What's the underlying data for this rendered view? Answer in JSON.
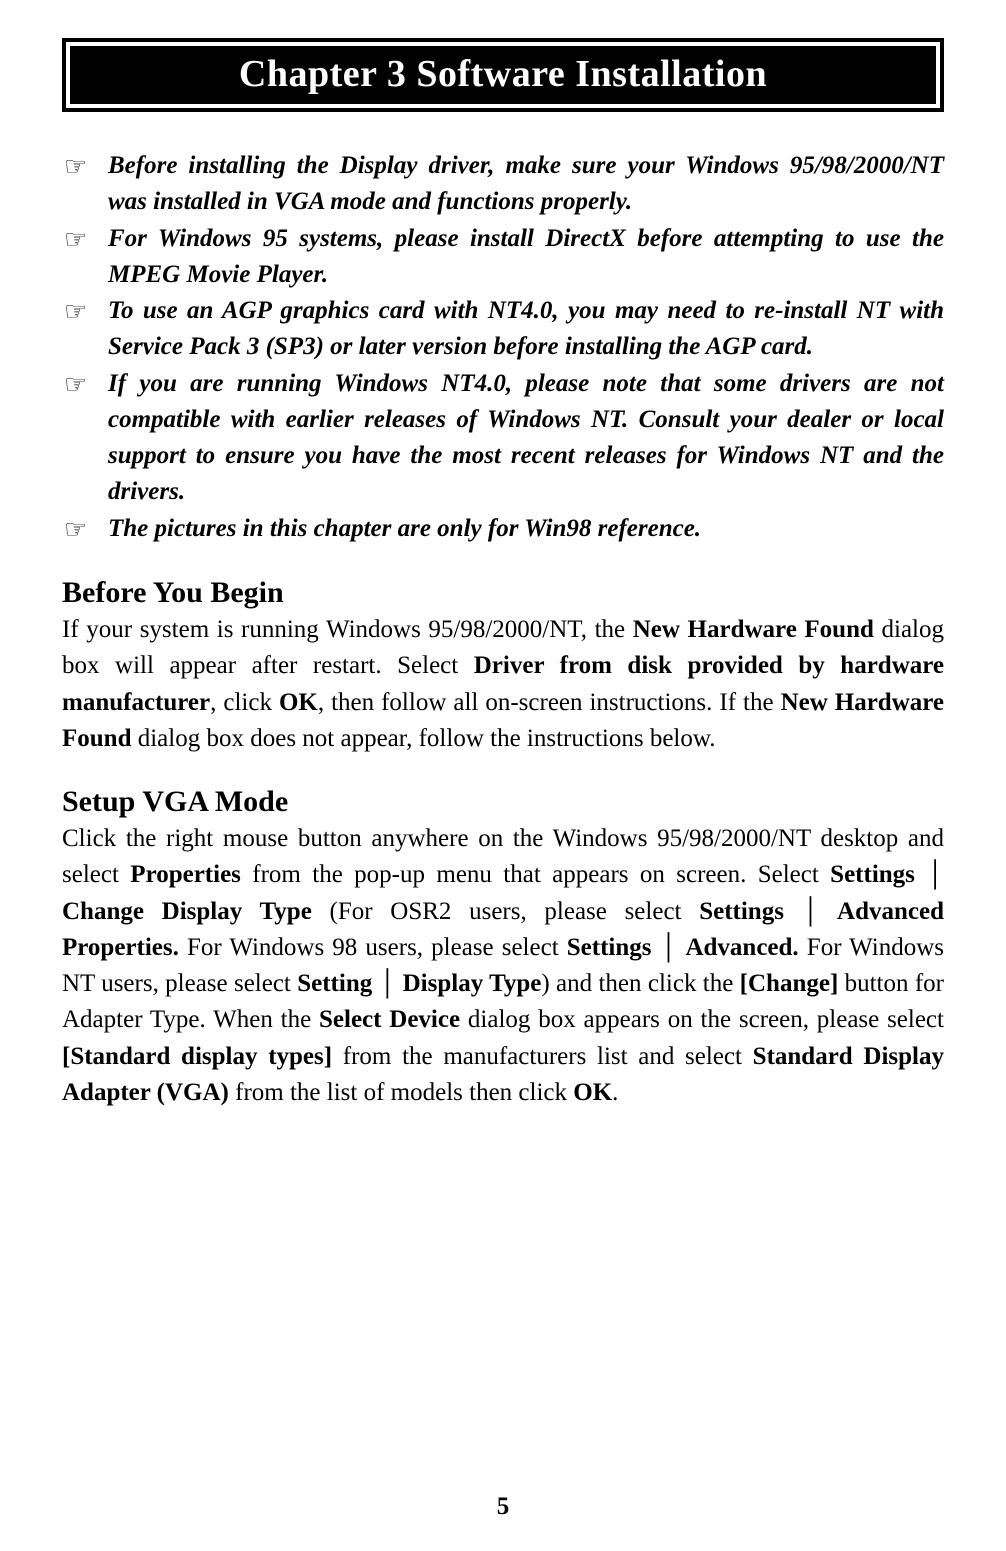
{
  "chapter": {
    "title": "Chapter 3 Software Installation"
  },
  "notes": {
    "items": [
      "Before installing the Display driver, make sure your Windows 95/98/2000/NT was installed in VGA mode and functions properly.",
      "For Windows 95 systems, please install DirectX before attempting to use the MPEG Movie Player.",
      "To use an AGP graphics card with NT4.0, you may need to re-install NT with Service Pack 3 (SP3) or later version before installing the AGP card.",
      "If you are running Windows NT4.0, please note that some drivers are not compatible with earlier releases of Windows NT.   Consult your dealer or local support to ensure you have the most recent releases for Windows NT and the drivers.",
      "The pictures in this chapter are only for Win98 reference."
    ],
    "bullet": "☞"
  },
  "sections": {
    "before_you_begin": {
      "heading": "Before You Begin",
      "p": {
        "t0": "If your system is running Windows 95/98/2000/NT, the ",
        "b0": "New Hardware Found",
        "t1": " dialog box will appear after restart.   Select ",
        "b1": "Driver from disk provided by hardware manufacturer",
        "t2": ", click ",
        "b2": "OK",
        "t3": ", then follow all on-screen instructions.   If the ",
        "b3": "New Hardware Found",
        "t4": " dialog box does not appear, follow the instructions below."
      }
    },
    "setup_vga_mode": {
      "heading": "Setup VGA Mode",
      "p": {
        "t0": "Click the right mouse button anywhere on the Windows 95/98/2000/NT desktop and select ",
        "b0": "Properties",
        "t1": " from the pop-up menu that appears on screen. Select ",
        "b1": "Settings",
        "s0": " │ ",
        "b2": "Change  Display Type",
        "t2": " (For OSR2 users, please select ",
        "b3": "Settings",
        "s1": " │ ",
        "b4": "Advanced Properties.",
        "t3": "   For Windows 98 users, please select ",
        "b5": "Settings",
        "s2": " │ ",
        "b6": "Advanced.",
        "t4": "   For Windows NT users, please select ",
        "b7": "Setting",
        "s3": " │ ",
        "b8": "Display Type",
        "t5": ") and then click the ",
        "b9": "[Change]",
        "t6": " button for Adapter Type. When the ",
        "b10": "Select Device",
        "t7": " dialog box appears on the screen, please select ",
        "b11": "[Standard display types]",
        "t8": " from the manufacturers list and select ",
        "b12": "Standard Display Adapter (VGA)",
        "t9": " from the list of models then click ",
        "b13": "OK",
        "t10": "."
      }
    }
  },
  "page_number": "5"
}
